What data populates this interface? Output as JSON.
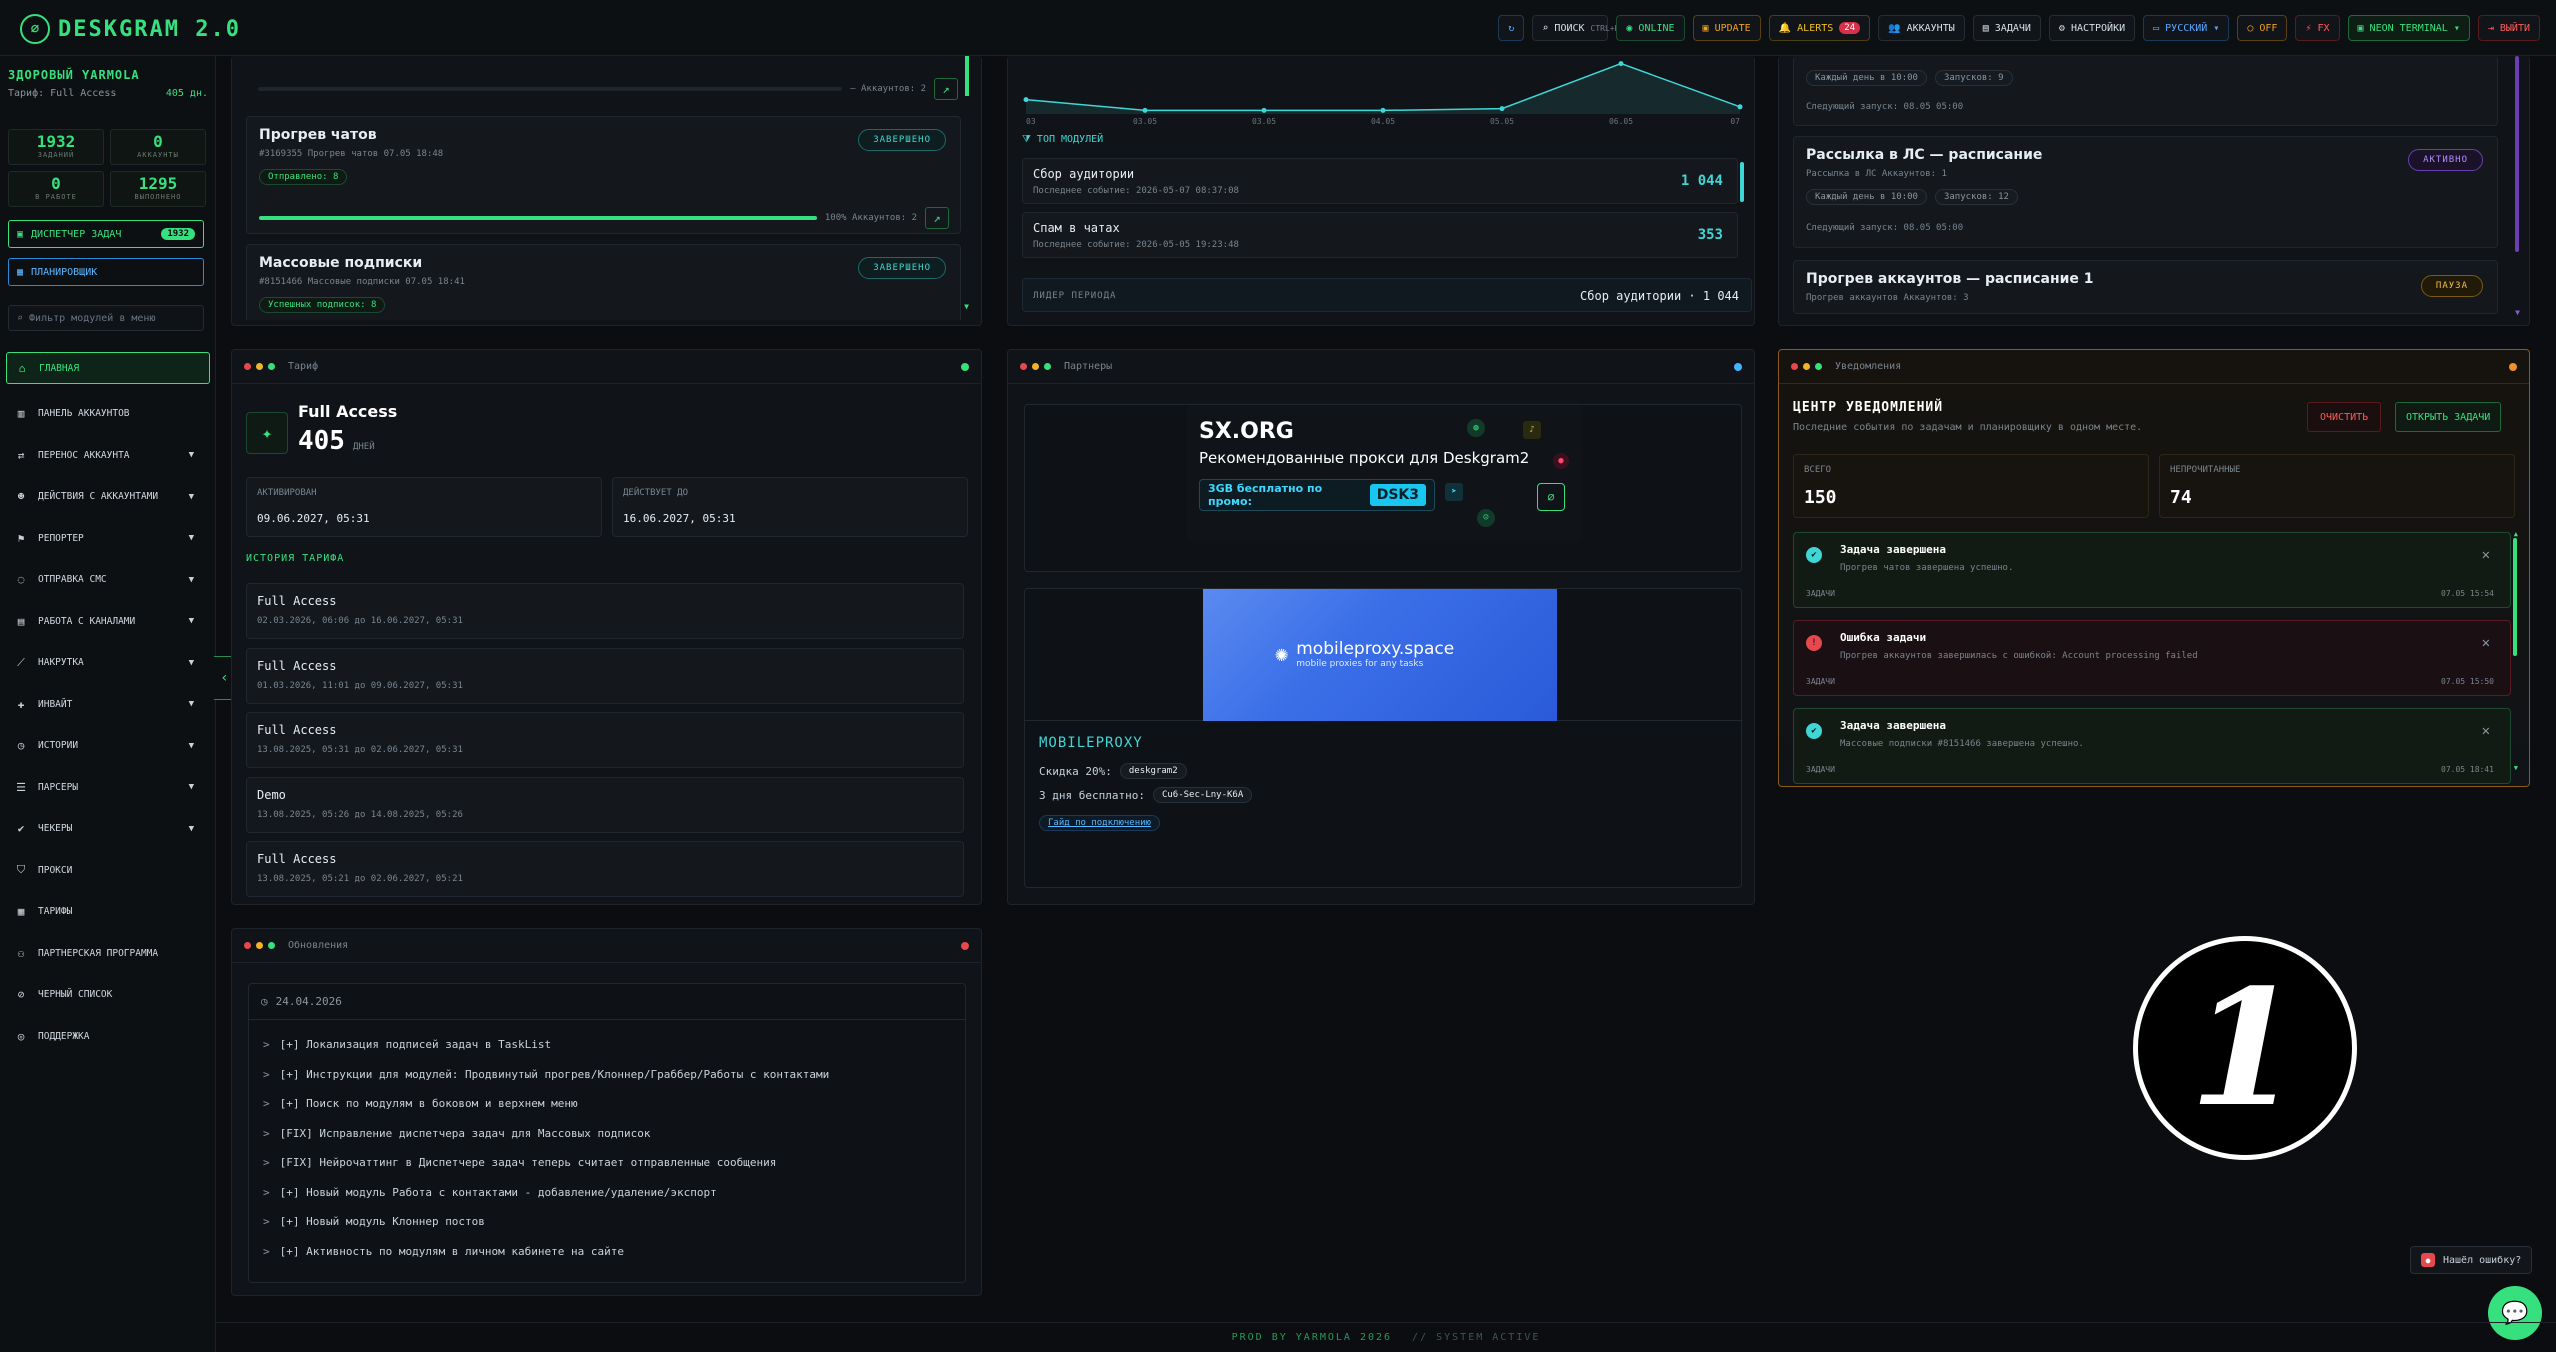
{
  "brand": {
    "name": "DESKGRAM 2.0"
  },
  "topbar": {
    "refresh_icon": "refresh-icon",
    "search": {
      "label": "ПОИСК",
      "shortcut": "CTRL+K"
    },
    "online": "ONLINE",
    "update": "UPDATE",
    "alerts": {
      "label": "ALERTS",
      "count": "24"
    },
    "accounts": "АККАУНТЫ",
    "tasks": "ЗАДАЧИ",
    "settings": "НАСТРОЙКИ",
    "language": "РУССКИЙ",
    "off": "OFF",
    "fx": "FX",
    "theme": "NEON TERMINAL",
    "logout": "ВЫЙТИ"
  },
  "sidebar": {
    "user_name": "ЗДОРОВЫЙ YARMOLA",
    "plan": "Тариф: Full Access",
    "days": "405 дн.",
    "stats": [
      {
        "value": "1932",
        "label": "ЗАДАНИЙ"
      },
      {
        "value": "0",
        "label": "АККАУНТЫ"
      },
      {
        "value": "0",
        "label": "В РАБОТЕ"
      },
      {
        "value": "1295",
        "label": "ВЫПОЛНЕНО"
      }
    ],
    "dispatcher": {
      "label": "ДИСПЕТЧЕР ЗАДАЧ",
      "badge": "1932"
    },
    "scheduler": "ПЛАНИРОВЩИК",
    "filter_placeholder": "Фильтр модулей в меню",
    "nav": [
      {
        "label": "ГЛАВНАЯ",
        "icon": "home-icon",
        "chev": ""
      },
      {
        "label": "ПАНЕЛЬ АККАУНТОВ",
        "icon": "users-icon",
        "chev": ""
      },
      {
        "label": "ПЕРЕНОС АККАУНТА",
        "icon": "transfer-icon",
        "chev": "▼"
      },
      {
        "label": "ДЕЙСТВИЯ С АККАУНТАМИ",
        "icon": "user-action-icon",
        "chev": "▼"
      },
      {
        "label": "РЕПОРТЕР",
        "icon": "flag-icon",
        "chev": "▼"
      },
      {
        "label": "ОТПРАВКА СМС",
        "icon": "chat-icon",
        "chev": "▼"
      },
      {
        "label": "РАБОТА С КАНАЛАМИ",
        "icon": "briefcase-icon",
        "chev": "▼"
      },
      {
        "label": "НАКРУТКА",
        "icon": "chart-icon",
        "chev": "▼"
      },
      {
        "label": "ИНВАЙТ",
        "icon": "user-plus-icon",
        "chev": "▼"
      },
      {
        "label": "ИСТОРИИ",
        "icon": "history-icon",
        "chev": "▼"
      },
      {
        "label": "ПАРСЕРЫ",
        "icon": "parser-icon",
        "chev": "▼"
      },
      {
        "label": "ЧЕКЕРЫ",
        "icon": "check-icon",
        "chev": "▼"
      },
      {
        "label": "ПРОКСИ",
        "icon": "shield-icon",
        "chev": ""
      },
      {
        "label": "ТАРИФЫ",
        "icon": "tariff-icon",
        "chev": ""
      },
      {
        "label": "ПАРТНЕРСКАЯ ПРОГРАММА",
        "icon": "partner-icon",
        "chev": ""
      },
      {
        "label": "ЧЕРНЫЙ СПИСОК",
        "icon": "blacklist-icon",
        "chev": ""
      },
      {
        "label": "ПОДДЕРЖКА",
        "icon": "support-icon",
        "chev": ""
      }
    ]
  },
  "tasks_panel": {
    "top_progress": {
      "text": "— Аккаунтов: 2"
    },
    "items": [
      {
        "title": "Прогрев чатов",
        "meta": "#3169355 Прогрев чатов 07.05 18:48",
        "chip": "Отправлено: 8",
        "status": "ЗАВЕРШЕНО",
        "progress_text": "100% Аккаунтов: 2",
        "progress": 1.0
      },
      {
        "title": "Массовые подписки",
        "meta": "#8151466 Массовые подписки 07.05 18:41",
        "chip": "Успешных подписок: 8",
        "status": "ЗАВЕРШЕНО"
      }
    ]
  },
  "modules_panel": {
    "chart_data": {
      "type": "line",
      "x": [
        "03",
        "03.05",
        "03.05",
        "04.05",
        "05.05",
        "06.05",
        "07"
      ],
      "values": [
        8,
        2,
        2,
        2,
        3,
        28,
        4
      ],
      "ylim": [
        0,
        30
      ]
    },
    "top_title": "ТОП МОДУЛЕЙ",
    "modules": [
      {
        "name": "Сбор аудитории",
        "meta": "Последнее событие: 2026-05-07 08:37:08",
        "value": "1 044"
      },
      {
        "name": "Спам в чатах",
        "meta": "Последнее событие: 2026-05-05 19:23:48",
        "value": "353"
      }
    ],
    "leader_label": "ЛИДЕР ПЕРИОДА",
    "leader_value": "Сбор аудитории · 1 044"
  },
  "schedule_panel": {
    "top_chips": [
      "Каждый день в 10:00",
      "Запусков: 9"
    ],
    "top_next": "Следующий запуск: 08.05 05:00",
    "items": [
      {
        "title": "Рассылка в ЛС — расписание",
        "meta": "Рассылка в ЛС Аккаунтов: 1",
        "chips": [
          "Каждый день в 10:00",
          "Запусков: 12"
        ],
        "next": "Следующий запуск: 08.05 05:00",
        "status": "АКТИВНО"
      },
      {
        "title": "Прогрев аккаунтов — расписание 1",
        "meta": "Прогрев аккаунтов Аккаунтов: 3",
        "status": "ПАУЗА"
      }
    ]
  },
  "tariff_panel": {
    "header": "Тариф",
    "name": "Full Access",
    "days": "405",
    "days_unit": "ДНЕЙ",
    "activated_label": "АКТИВИРОВАН",
    "activated": "09.06.2027, 05:31",
    "valid_label": "ДЕЙСТВУЕТ ДО",
    "valid": "16.06.2027, 05:31",
    "history_title": "ИСТОРИЯ ТАРИФА",
    "history": [
      {
        "name": "Full Access",
        "dates": "02.03.2026, 06:06 до 16.06.2027, 05:31"
      },
      {
        "name": "Full Access",
        "dates": "01.03.2026, 11:01 до 09.06.2027, 05:31"
      },
      {
        "name": "Full Access",
        "dates": "13.08.2025, 05:31 до 02.06.2027, 05:31"
      },
      {
        "name": "Demo",
        "dates": "13.08.2025, 05:26 до 14.08.2025, 05:26"
      },
      {
        "name": "Full Access",
        "dates": "13.08.2025, 05:21 до 02.06.2027, 05:21"
      }
    ]
  },
  "partners_panel": {
    "header": "Партнеры",
    "sx": {
      "logo": "SX.ORG",
      "title": "Рекомендованные прокси для Deskgram2",
      "promo_text": "3GB бесплатно по промо:",
      "promo_code": "DSK3"
    },
    "mp": {
      "logo": "mobileproxy.space",
      "tagline": "mobile proxies for any tasks",
      "name": "MOBILEPROXY",
      "discount_label": "Скидка 20%:",
      "discount_code": "deskgram2",
      "free_label": "3 дня бесплатно:",
      "free_code": "Cu6-Sec-Lny-K6A",
      "guide": "Гайд по подключению"
    }
  },
  "notifications_panel": {
    "header": "Уведомления",
    "title": "ЦЕНТР УВЕДОМЛЕНИЙ",
    "subtitle": "Последние события по задачам и планировщику в одном месте.",
    "clear": "ОЧИСТИТЬ",
    "open_tasks": "ОТКРЫТЬ ЗАДАЧИ",
    "total_label": "ВСЕГО",
    "total": "150",
    "unread_label": "НЕПРОЧИТАННЫЕ",
    "unread": "74",
    "items": [
      {
        "title": "Задача завершена",
        "text": "Прогрев чатов завершена успешно.",
        "cat": "ЗАДАЧИ",
        "time": "07.05 15:54",
        "kind": "ok"
      },
      {
        "title": "Ошибка задачи",
        "text": "Прогрев аккаунтов завершилась с ошибкой: Account processing failed",
        "cat": "ЗАДАЧИ",
        "time": "07.05 15:50",
        "kind": "err"
      },
      {
        "title": "Задача завершена",
        "text": "Массовые подписки #8151466 завершена успешно.",
        "cat": "ЗАДАЧИ",
        "time": "07.05 18:41",
        "kind": "ok"
      }
    ]
  },
  "updates_panel": {
    "header": "Обновления",
    "date": "24.04.2026",
    "lines": [
      "[+] Локализация подписей задач в TaskList",
      "[+] Инструкции для модулей: Продвинутый прогрев/Клоннер/Граббер/Работы с контактами",
      "[+] Поиск по модулям в боковом и верхнем меню",
      "[FIX] Исправление диспетчера задач для Массовых подписок",
      "[FIX] Нейрочаттинг в Диспетчере задач теперь считает отправленные сообщения",
      "[+] Новый модуль Работа с контактами - добавление/удаление/экспорт",
      "[+] Новый модуль Клоннер постов",
      "[+] Активность по модулям в личном кабинете на сайте"
    ]
  },
  "overlay": {
    "number": "1"
  },
  "bug_button": "Нашёл ошибку?",
  "footer": {
    "left": "PROD BY YARMOLA 2026",
    "right": "// SYSTEM ACTIVE"
  }
}
